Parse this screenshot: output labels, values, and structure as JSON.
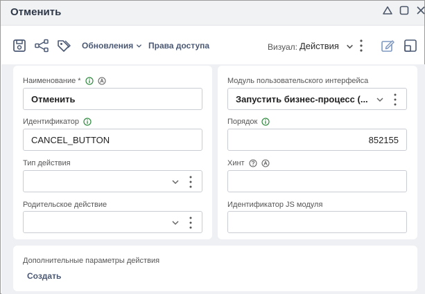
{
  "window": {
    "title": "Отменить",
    "controls": [
      "minimize-triangle-icon",
      "maximize-icon",
      "close-icon"
    ]
  },
  "toolbar": {
    "icons": [
      "save-icon",
      "share-nodes-icon",
      "tags-icon"
    ],
    "updates_label": "Обновления",
    "access_label": "Права доступа",
    "visual_label": "Визуал:",
    "visual_value": "Действия",
    "right_icons": [
      "edit-icon",
      "open-in-window-icon"
    ]
  },
  "left_card": {
    "name_label": "Наименование *",
    "name_value": "Отменить",
    "id_label": "Идентификатор",
    "id_value": "CANCEL_BUTTON",
    "action_type_label": "Тип действия",
    "action_type_value": "",
    "parent_action_label": "Родительское действие",
    "parent_action_value": ""
  },
  "right_card": {
    "ui_module_label": "Модуль пользовательского интерфейса",
    "ui_module_value": "Запустить бизнес-процесс (...",
    "order_label": "Порядок",
    "order_value": "852155",
    "hint_label": "Хинт",
    "hint_value": "",
    "js_module_label": "Идентификатор JS модуля",
    "js_module_value": ""
  },
  "extra": {
    "label": "Дополнительные параметры действия",
    "create_label": "Создать"
  },
  "colors": {
    "accent": "#4a5874",
    "info_green": "#2e8b3e",
    "background": "#eef0f3",
    "border": "#c9cdd3"
  }
}
